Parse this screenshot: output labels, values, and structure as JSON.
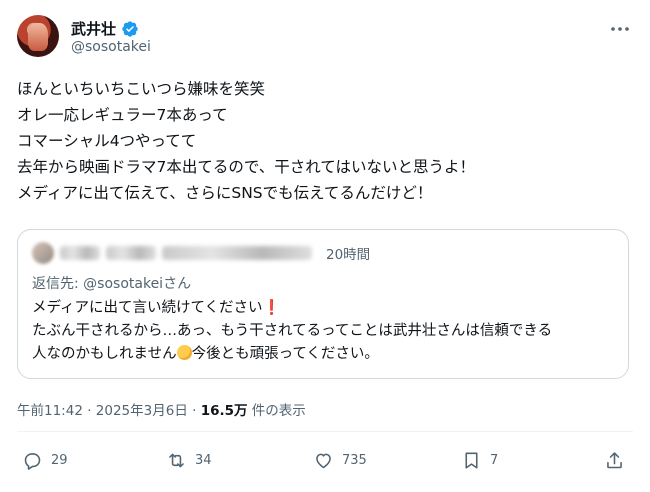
{
  "author": {
    "name": "武井壮",
    "handle": "@sosotakei"
  },
  "tweet": {
    "lines": [
      "ほんといちいちこいつら嫌味を笑笑",
      "オレ一応レギュラー7本あって",
      "コマーシャル4つやってて",
      "去年から映画ドラマ7本出てるので、干されてはいないと思うよ！",
      "メディアに出て伝えて、さらにSNSでも伝えてるんだけど！"
    ]
  },
  "quote": {
    "time": "20時間",
    "reply_prefix": "返信先: ",
    "reply_handle": "@sosotakeiさん",
    "line1": "メディアに出て言い続けてください",
    "line2": "たぶん干されるから…あっ、もう干されてるってことは武井壮さんは信頼できる",
    "line3a": "人なのかもしれません",
    "line3b": "今後とも頑張ってください。"
  },
  "meta": {
    "time": "午前11:42 · 2025年3月6日 · ",
    "views": "16.5万",
    "views_suffix": " 件の表示"
  },
  "actions": {
    "replies": "29",
    "reposts": "34",
    "likes": "735",
    "bookmarks": "7"
  },
  "colors": {
    "verified": "#1d9bf0",
    "secondary_text": "#536471",
    "border": "#cfd9de"
  }
}
